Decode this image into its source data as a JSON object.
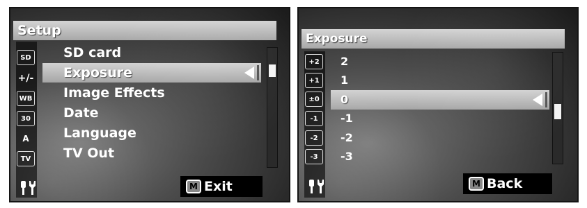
{
  "setup_screen": {
    "title": "Setup",
    "items": [
      {
        "label": "SD card",
        "icon": "sd-card-icon",
        "icon_text": "SD"
      },
      {
        "label": "Exposure",
        "icon": "exposure-icon",
        "icon_text": "+/-"
      },
      {
        "label": "Image Effects",
        "icon": "white-balance-icon",
        "icon_text": "WB"
      },
      {
        "label": "Date",
        "icon": "calendar-icon",
        "icon_text": "30"
      },
      {
        "label": "Language",
        "icon": "language-icon",
        "icon_text": "A"
      },
      {
        "label": "TV Out",
        "icon": "tv-icon",
        "icon_text": "TV"
      }
    ],
    "selected_index": 1,
    "footer_key": "M",
    "footer_label": "Exit",
    "tools_icon": "wrench-icon"
  },
  "exposure_screen": {
    "title": "Exposure",
    "items": [
      {
        "label": "2",
        "icon": "ev-plus-2-icon",
        "icon_text": "+2"
      },
      {
        "label": "1",
        "icon": "ev-plus-1-icon",
        "icon_text": "+1"
      },
      {
        "label": "0",
        "icon": "ev-zero-icon",
        "icon_text": "±0"
      },
      {
        "label": "-1",
        "icon": "ev-minus-1-icon",
        "icon_text": "-1"
      },
      {
        "label": "-2",
        "icon": "ev-minus-2-icon",
        "icon_text": "-2"
      },
      {
        "label": "-3",
        "icon": "ev-minus-3-icon",
        "icon_text": "-3"
      }
    ],
    "selected_index": 2,
    "footer_key": "M",
    "footer_label": "Back",
    "tools_icon": "wrench-icon"
  }
}
